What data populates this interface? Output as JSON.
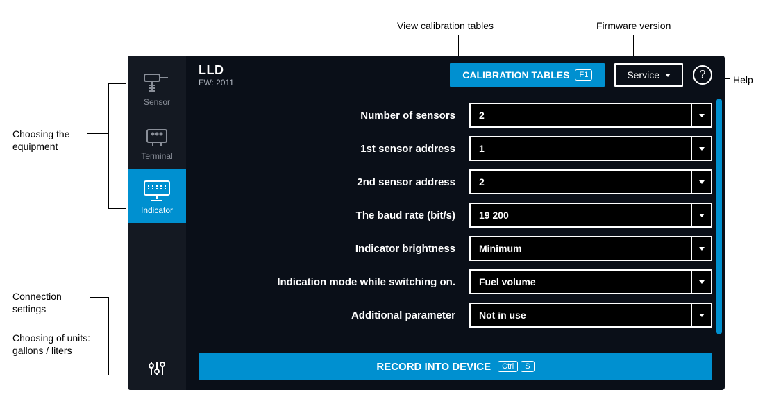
{
  "annotations": {
    "calibration": "View calibration tables",
    "firmware": "Firmware version",
    "help": "Help",
    "equipment": "Choosing the equipment",
    "connection": "Connection settings",
    "units": "Choosing of units: gallons / liters"
  },
  "header": {
    "title": "LLD",
    "firmware": "FW: 2011",
    "calib_button": "CALIBRATION TABLES",
    "calib_key": "F1",
    "service": "Service",
    "help_symbol": "?"
  },
  "sidebar": {
    "sensor": "Sensor",
    "terminal": "Terminal",
    "indicator": "Indicator"
  },
  "form": {
    "rows": [
      {
        "label": "Number of sensors",
        "value": "2"
      },
      {
        "label": "1st sensor address",
        "value": "1"
      },
      {
        "label": "2nd sensor address",
        "value": "2"
      },
      {
        "label": "The baud rate (bit/s)",
        "value": "19 200"
      },
      {
        "label": "Indicator brightness",
        "value": "Minimum"
      },
      {
        "label": "Indication mode while switching on.",
        "value": "Fuel volume"
      },
      {
        "label": "Additional parameter",
        "value": "Not in use"
      }
    ]
  },
  "footer": {
    "record": "RECORD INTO DEVICE",
    "key1": "Ctrl",
    "key2": "S"
  }
}
